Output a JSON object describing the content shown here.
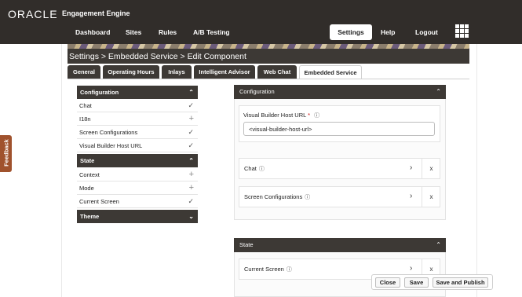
{
  "header": {
    "brand": "ORACLE",
    "product": "Engagement Engine",
    "nav": [
      "Dashboard",
      "Sites",
      "Rules",
      "A/B Testing"
    ],
    "active_nav": "Settings",
    "right_nav": [
      "Help",
      "Logout"
    ]
  },
  "breadcrumb": "Settings > Embedded Service > Edit Component",
  "tabs": [
    {
      "label": "General",
      "active": false
    },
    {
      "label": "Operating Hours",
      "active": false
    },
    {
      "label": "Inlays",
      "active": false
    },
    {
      "label": "Intelligent Advisor",
      "active": false
    },
    {
      "label": "Web Chat",
      "active": false
    },
    {
      "label": "Embedded Service",
      "active": true
    }
  ],
  "left_panel": {
    "configuration": {
      "title": "Configuration",
      "items": [
        {
          "label": "Chat",
          "icon": "check-icon"
        },
        {
          "label": "I18n",
          "icon": "plus-icon"
        },
        {
          "label": "Screen Configurations",
          "icon": "check-icon"
        },
        {
          "label": "Visual Builder Host URL",
          "icon": "check-icon"
        }
      ]
    },
    "state": {
      "title": "State",
      "items": [
        {
          "label": "Context",
          "icon": "plus-icon"
        },
        {
          "label": "Mode",
          "icon": "plus-icon"
        },
        {
          "label": "Current Screen",
          "icon": "check-icon"
        }
      ]
    },
    "theme": {
      "title": "Theme"
    }
  },
  "right_panel": {
    "configuration": {
      "title": "Configuration",
      "url_label": "Visual Builder Host URL",
      "url_required": "*",
      "url_value": "<visual-builder-host-url>",
      "rows": [
        {
          "label": "Chat",
          "remove": "x"
        },
        {
          "label": "Screen Configurations",
          "remove": "x"
        }
      ]
    },
    "state": {
      "title": "State",
      "rows": [
        {
          "label": "Current Screen",
          "remove": "x"
        }
      ]
    }
  },
  "feedback": "Feedback",
  "actions": {
    "close": "Close",
    "save": "Save",
    "save_publish": "Save and Publish"
  },
  "icons": {
    "check": "✓",
    "plus": "+",
    "chevron_up": "⌃",
    "chevron_down": "⌄",
    "chevron_right": "›",
    "info": "ⓘ"
  }
}
